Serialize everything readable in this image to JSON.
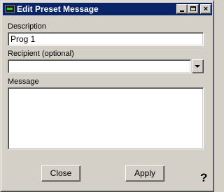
{
  "window": {
    "title": "Edit Preset Message",
    "minimize_glyph": "_",
    "maximize_glyph": "□",
    "close_glyph": "×"
  },
  "form": {
    "description_label": "Description",
    "description_value": "Prog 1",
    "recipient_label": "Recipient (optional)",
    "recipient_value": "",
    "message_label": "Message",
    "message_value": ""
  },
  "buttons": {
    "close_label": "Close",
    "apply_label": "Apply",
    "help_label": "?"
  },
  "icons": {
    "title_icon": "app-icon",
    "dropdown_icon": "chevron-down-icon"
  },
  "colors": {
    "titlebar": "#0a246a",
    "face": "#d4d0c8"
  }
}
